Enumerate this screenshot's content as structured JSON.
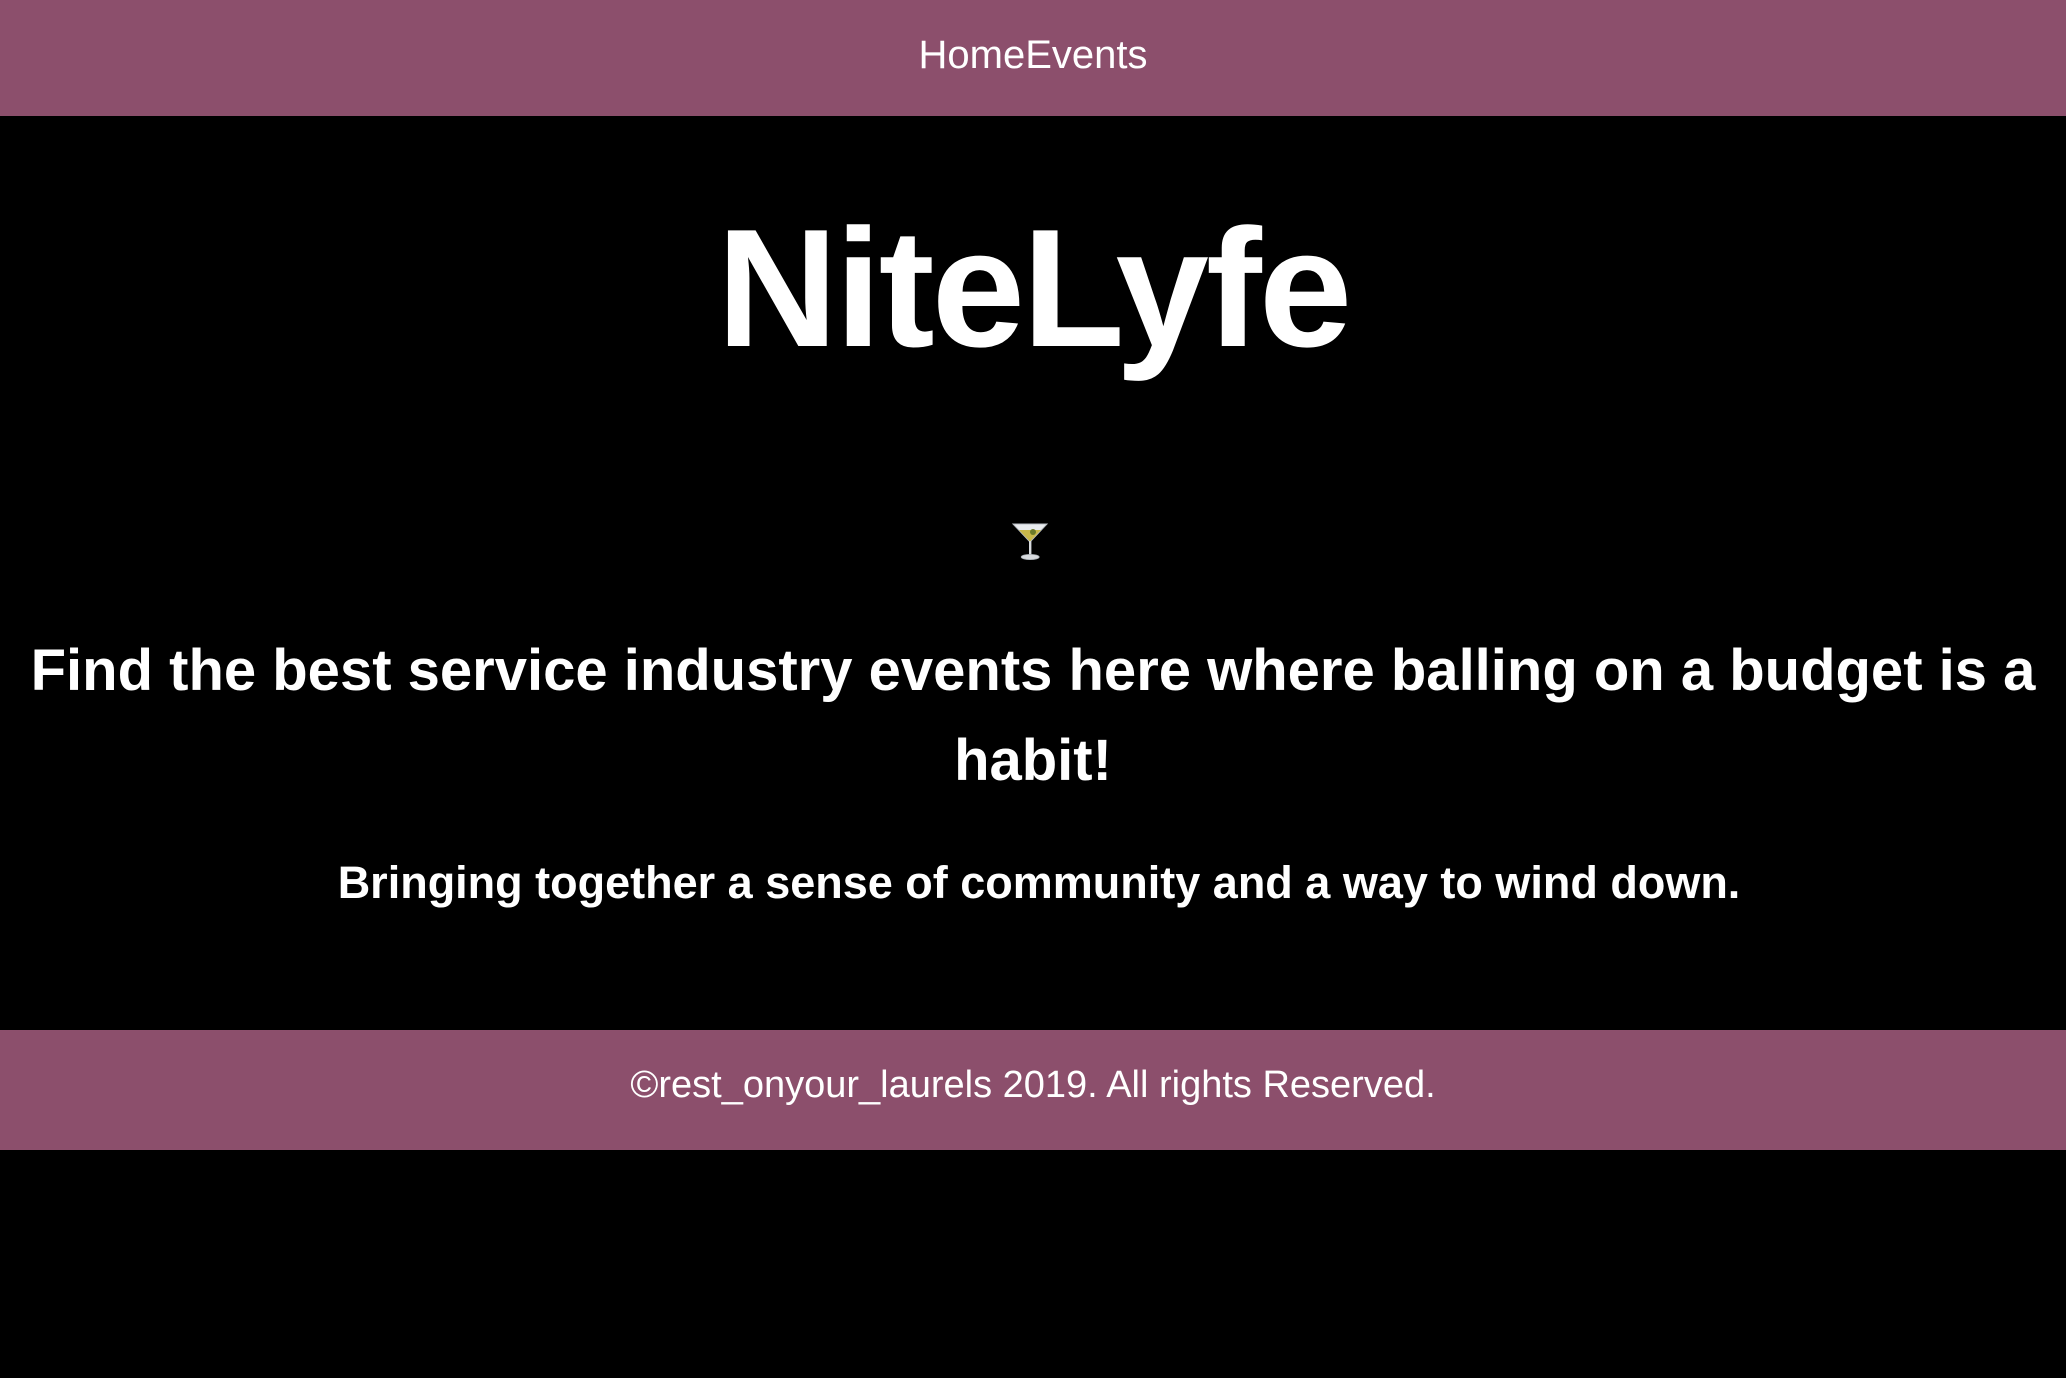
{
  "colors": {
    "bar_background": "#8c4f6c",
    "page_background": "#000000",
    "text": "#ffffff"
  },
  "nav": {
    "items": [
      {
        "label": "Home"
      },
      {
        "label": "Events"
      }
    ]
  },
  "hero": {
    "title": "NiteLyfe",
    "icon": "cocktail-glass-icon",
    "tagline": "Find the best service industry events here where balling on a budget is a habit!",
    "subtagline": "Bringing together a sense of community and a way to wind down."
  },
  "footer": {
    "copyright": "©rest_onyour_laurels 2019. All rights Reserved."
  }
}
